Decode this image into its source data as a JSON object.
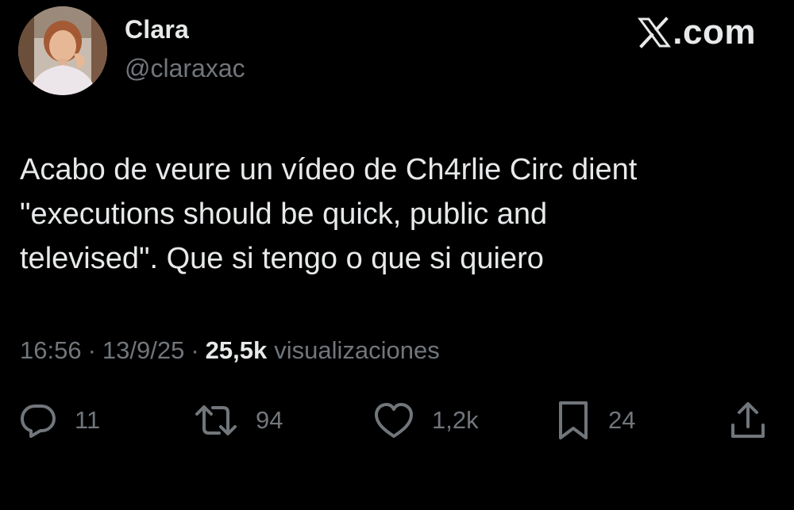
{
  "author": {
    "name": "Clara",
    "handle": "@claraxac"
  },
  "brand": {
    "text": ".com",
    "logo_icon": "x-logo-icon"
  },
  "tweet": {
    "text": "Acabo de veure un vídeo de Ch4rlie Circ dient\n\"executions should be quick, public and\ntelevised\". Que si tengo o que si quiero"
  },
  "meta": {
    "time": "16:56",
    "separator": "·",
    "date": "13/9/25",
    "views_count": "25,5k",
    "views_label": "visualizaciones"
  },
  "actions": {
    "reply": {
      "icon": "reply-icon",
      "count": "11"
    },
    "retweet": {
      "icon": "retweet-icon",
      "count": "94"
    },
    "like": {
      "icon": "heart-icon",
      "count": "1,2k"
    },
    "bookmark": {
      "icon": "bookmark-icon",
      "count": "24"
    },
    "share": {
      "icon": "share-icon"
    }
  },
  "colors": {
    "background": "#000000",
    "primary_text": "#e7e9ea",
    "secondary_text": "#71767b"
  }
}
